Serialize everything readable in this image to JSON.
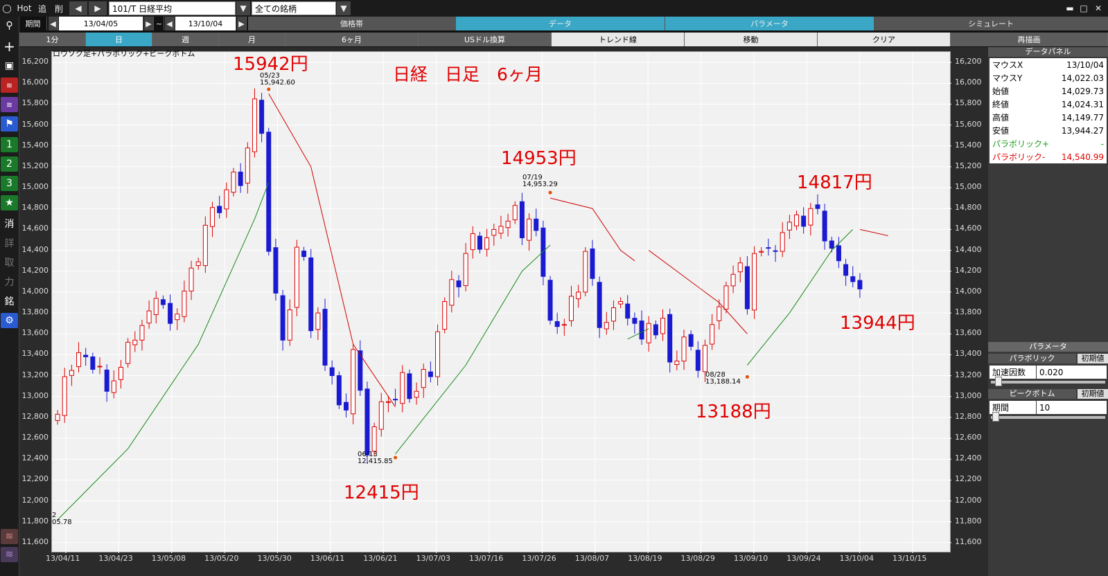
{
  "toolbar": {
    "hot": "Hot",
    "add": "追",
    "del": "削",
    "symbol": "101/T 日経平均",
    "filter": "全ての銘柄"
  },
  "period": {
    "label": "期間",
    "from": "13/04/05",
    "sep": "~",
    "to": "13/10/04"
  },
  "tabs": {
    "price_band": "価格帯",
    "data": "データ",
    "params": "パラメータ",
    "simulate": "シミュレート"
  },
  "ranges": {
    "m1": "1分",
    "day": "日",
    "week": "週",
    "month": "月",
    "m6": "6ヶ月",
    "usd": "USドル換算",
    "trend": "トレンド線",
    "move": "移動",
    "clear": "クリア",
    "redraw": "再描画"
  },
  "left_tools": {
    "t1": "1",
    "t2": "2",
    "t3": "3",
    "k1": "消",
    "k2": "詳",
    "k3": "取",
    "k4": "力",
    "k5": "銘"
  },
  "chart": {
    "subtitle": "ロウソク足+パラボリック+ピークボトム",
    "title": "日経　日足　6ヶ月",
    "ann": [
      "15942円",
      "14953円",
      "14817円",
      "13944円",
      "12415円",
      "13188円"
    ],
    "peaks": [
      {
        "d": "05/23",
        "v": "15,942.60"
      },
      {
        "d": "07/19",
        "v": "14,953.29"
      },
      {
        "d": "06/13",
        "v": "12,415.85"
      },
      {
        "d": "08/28",
        "v": "13,188.14"
      }
    ],
    "left_partial": {
      "d": "2",
      "v": "05.78"
    }
  },
  "panel": {
    "title": "データパネル",
    "rows": [
      [
        "マウスX",
        "13/10/04"
      ],
      [
        "マウスY",
        "14,022.03"
      ],
      [
        "始値",
        "14,029.73"
      ],
      [
        "終値",
        "14,024.31"
      ],
      [
        "高値",
        "14,149.77"
      ],
      [
        "安値",
        "13,944.27"
      ]
    ],
    "para_plus": "パラボリック+",
    "para_plus_v": "-",
    "para_minus": "パラボリック-",
    "para_minus_v": "14,540.99",
    "param_title": "パラメータ",
    "parabolic": "パラボリック",
    "reset": "初期値",
    "accel": "加速因数",
    "accel_v": "0.020",
    "peak": "ピークボトム",
    "period": "期間",
    "period_v": "10"
  },
  "chart_data": {
    "type": "candlestick",
    "title": "日経　日足　6ヶ月",
    "y_ticks": [
      11600,
      11800,
      12000,
      12200,
      12400,
      12600,
      12800,
      13000,
      13200,
      13400,
      13600,
      13800,
      14000,
      14200,
      14400,
      14600,
      14800,
      15000,
      15200,
      15400,
      15600,
      15800,
      16000,
      16200
    ],
    "y_labels": [
      "11,600",
      "11,800",
      "12,000",
      "12,200",
      "12,400",
      "12,600",
      "12,800",
      "13,000",
      "13,200",
      "13,400",
      "13,600",
      "13,800",
      "14,000",
      "14,200",
      "14,400",
      "14,600",
      "14,800",
      "15,000",
      "15,200",
      "15,400",
      "15,600",
      "15,800",
      "16,000",
      "16,200"
    ],
    "ylim": [
      11500,
      16300
    ],
    "x_labels": [
      "13/04/11",
      "13/04/23",
      "13/05/08",
      "13/05/20",
      "13/05/30",
      "13/06/11",
      "13/06/21",
      "13/07/03",
      "13/07/16",
      "13/07/26",
      "13/08/07",
      "13/08/19",
      "13/08/29",
      "13/09/10",
      "13/09/24",
      "13/10/04",
      "13/10/15"
    ],
    "closes": [
      12830,
      13190,
      13250,
      13420,
      13380,
      13260,
      13290,
      13050,
      13150,
      13280,
      13520,
      13540,
      13680,
      13820,
      13940,
      13880,
      13700,
      13790,
      14010,
      14230,
      14290,
      14640,
      14810,
      14760,
      14980,
      15150,
      15020,
      15380,
      15850,
      15520,
      14390,
      13990,
      13540,
      13830,
      14430,
      14340,
      13630,
      13800,
      13300,
      13200,
      12920,
      12870,
      13450,
      13060,
      12440,
      12710,
      12950,
      12950,
      12970,
      13230,
      12980,
      13050,
      13260,
      13190,
      13620,
      13910,
      14120,
      14050,
      14370,
      14560,
      14410,
      14520,
      14600,
      14630,
      14680,
      14830,
      14520,
      14700,
      14590,
      14150,
      13730,
      13670,
      13690,
      13960,
      14000,
      14390,
      14130,
      13660,
      13710,
      13850,
      13910,
      13750,
      13700,
      13550,
      13700,
      13590,
      13750,
      13330,
      13340,
      13570,
      13480,
      13250,
      13490,
      13690,
      13860,
      14060,
      14170,
      14280,
      13840,
      14370,
      14390,
      14420,
      14390,
      14570,
      14670,
      14740,
      14630,
      14800,
      14800,
      14490,
      14420,
      14300,
      14160,
      14100,
      14030
    ]
  }
}
